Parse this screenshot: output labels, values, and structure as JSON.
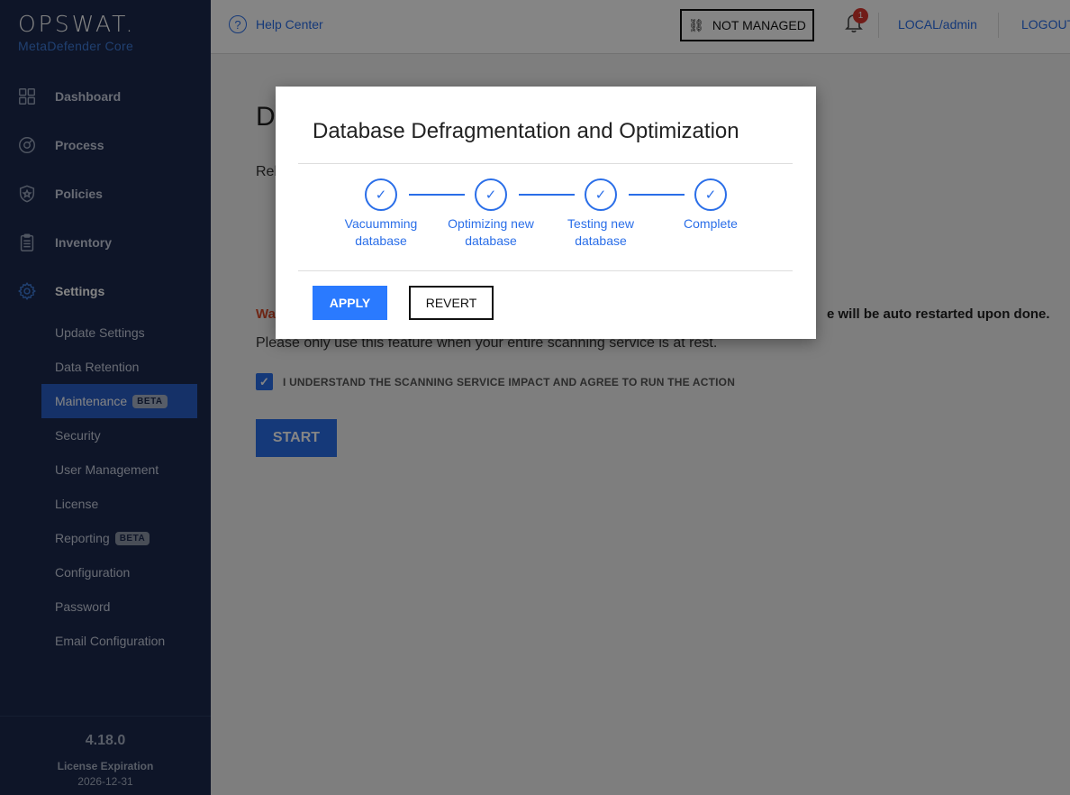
{
  "brand": {
    "logo": "OPSWAT.",
    "product": "MetaDefender Core"
  },
  "sidebar": {
    "items": [
      {
        "label": "Dashboard",
        "icon": "dashboard-icon"
      },
      {
        "label": "Process",
        "icon": "process-icon"
      },
      {
        "label": "Policies",
        "icon": "policies-icon"
      },
      {
        "label": "Inventory",
        "icon": "inventory-icon"
      },
      {
        "label": "Settings",
        "icon": "settings-icon"
      }
    ],
    "settings_sub": [
      {
        "label": "Update Settings"
      },
      {
        "label": "Data Retention"
      },
      {
        "label": "Maintenance",
        "badge": "BETA"
      },
      {
        "label": "Security"
      },
      {
        "label": "User Management"
      },
      {
        "label": "License"
      },
      {
        "label": "Reporting",
        "badge": "BETA"
      },
      {
        "label": "Configuration"
      },
      {
        "label": "Password"
      },
      {
        "label": "Email Configuration"
      }
    ],
    "footer": {
      "version": "4.18.0",
      "license_label": "License Expiration",
      "license_date": "2026-12-31"
    }
  },
  "header": {
    "help_label": "Help Center",
    "status_label": "NOT MANAGED",
    "notification_count": "1",
    "user_label": "LOCAL/admin",
    "logout_label": "LOGOUT"
  },
  "main": {
    "title_visible": "D",
    "desc_visible": "Reb",
    "warning_label": "Wa",
    "warning_tail": "e will be auto restarted upon done.",
    "note": "Please only use this feature when your entire scanning service is at rest.",
    "agree_label": "I UNDERSTAND THE SCANNING SERVICE IMPACT AND AGREE TO RUN THE ACTION",
    "agree_checked": true,
    "start_label": "START"
  },
  "modal": {
    "title": "Database Defragmentation and Optimization",
    "steps": [
      {
        "line1": "Vacuumming",
        "line2": "database",
        "status": "done"
      },
      {
        "line1": "Optimizing new",
        "line2": "database",
        "status": "done"
      },
      {
        "line1": "Testing new",
        "line2": "database",
        "status": "done"
      },
      {
        "line1": "Complete",
        "line2": "",
        "status": "done"
      }
    ],
    "apply_label": "APPLY",
    "revert_label": "REVERT"
  },
  "colors": {
    "accent": "#2a6ee8",
    "sidebar_bg": "#1c2a4d",
    "warning": "#d64a2a",
    "badge": "#d9362f"
  }
}
